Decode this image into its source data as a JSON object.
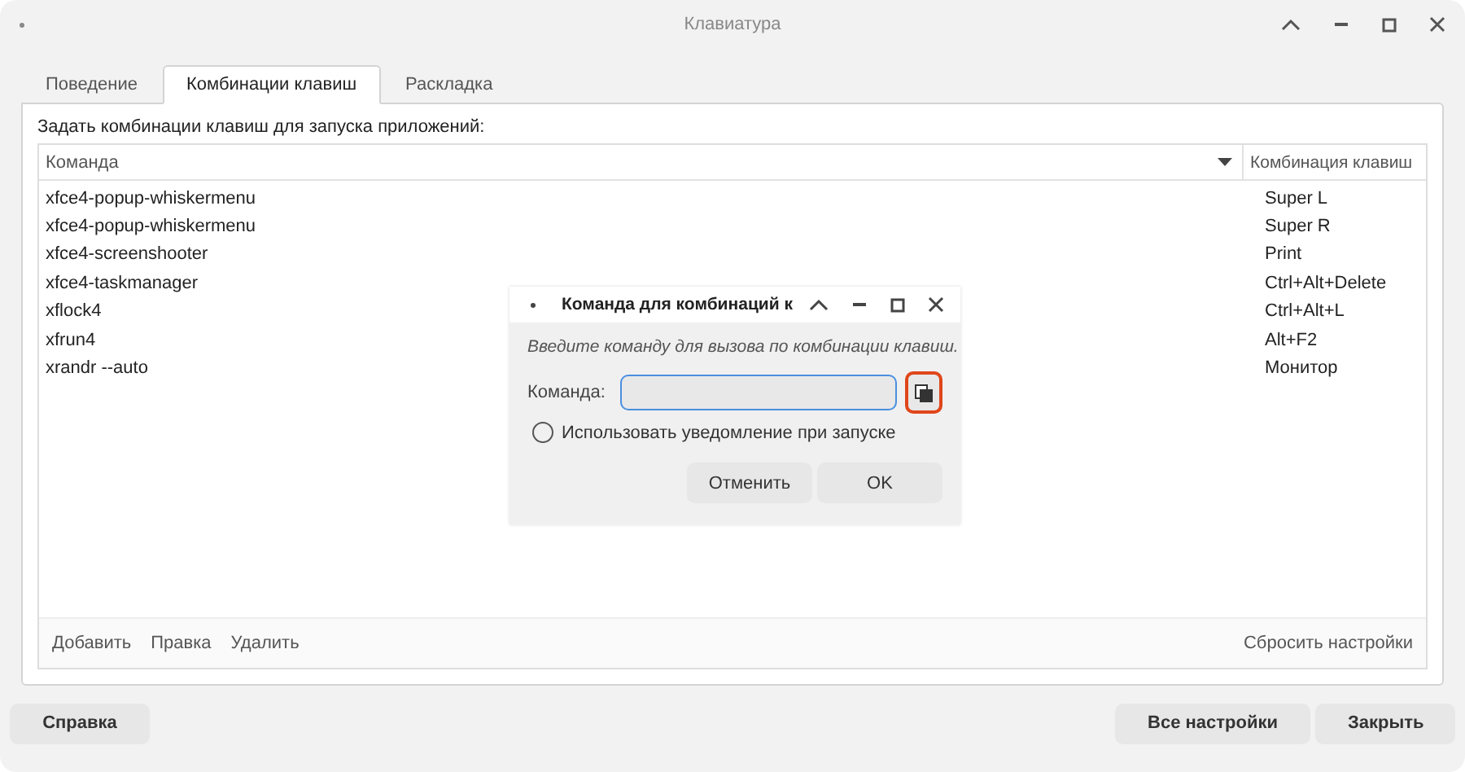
{
  "window": {
    "title": "Клавиатура"
  },
  "tabs": [
    {
      "label": "Поведение",
      "selected": false
    },
    {
      "label": "Комбинации клавиш",
      "selected": true
    },
    {
      "label": "Раскладка",
      "selected": false
    }
  ],
  "section_label": "Задать комбинации клавиш для запуска приложений:",
  "table": {
    "columns": [
      "Команда",
      "Комбинация клавиш"
    ],
    "rows": [
      {
        "command": "xfce4-popup-whiskermenu",
        "shortcut": "Super L"
      },
      {
        "command": "xfce4-popup-whiskermenu",
        "shortcut": "Super R"
      },
      {
        "command": "xfce4-screenshooter",
        "shortcut": "Print"
      },
      {
        "command": "xfce4-taskmanager",
        "shortcut": "Ctrl+Alt+Delete"
      },
      {
        "command": "xflock4",
        "shortcut": "Ctrl+Alt+L"
      },
      {
        "command": "xfrun4",
        "shortcut": "Alt+F2"
      },
      {
        "command": "xrandr --auto",
        "shortcut": "Монитор"
      }
    ]
  },
  "table_actions": [
    "Добавить",
    "Правка",
    "Удалить"
  ],
  "reset_button": "Сбросить настройки",
  "help_button": "Справка",
  "footer_buttons": [
    "Все настройки",
    "Закрыть"
  ],
  "dialog": {
    "title": "Команда для комбинаций к",
    "prompt": "Введите команду для вызова по комбинации клавиш.",
    "field_label": "Команда:",
    "notify": {
      "label": "Использовать уведомление при запуске",
      "checked": false
    },
    "buttons": [
      "Отменить",
      "OK"
    ]
  }
}
